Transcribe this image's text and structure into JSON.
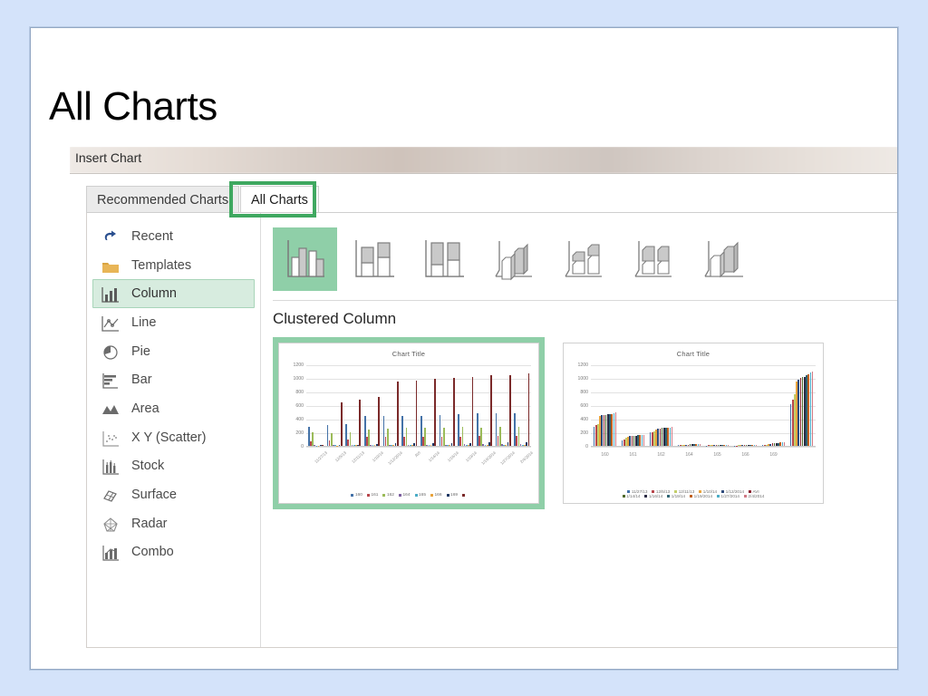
{
  "slide": {
    "title": "All Charts"
  },
  "dialog": {
    "title": "Insert Chart",
    "tabs": [
      {
        "label": "Recommended Charts",
        "selected": false
      },
      {
        "label": "All Charts",
        "selected": true
      }
    ],
    "sidebar": [
      {
        "label": "Recent",
        "icon": "undo-arrow-icon",
        "selected": false
      },
      {
        "label": "Templates",
        "icon": "folder-icon",
        "selected": false
      },
      {
        "label": "Column",
        "icon": "column-chart-icon",
        "selected": true
      },
      {
        "label": "Line",
        "icon": "line-chart-icon",
        "selected": false
      },
      {
        "label": "Pie",
        "icon": "pie-chart-icon",
        "selected": false
      },
      {
        "label": "Bar",
        "icon": "bar-chart-icon",
        "selected": false
      },
      {
        "label": "Area",
        "icon": "area-chart-icon",
        "selected": false
      },
      {
        "label": "X Y (Scatter)",
        "icon": "scatter-chart-icon",
        "selected": false
      },
      {
        "label": "Stock",
        "icon": "stock-chart-icon",
        "selected": false
      },
      {
        "label": "Surface",
        "icon": "surface-chart-icon",
        "selected": false
      },
      {
        "label": "Radar",
        "icon": "radar-chart-icon",
        "selected": false
      },
      {
        "label": "Combo",
        "icon": "combo-chart-icon",
        "selected": false
      }
    ],
    "subtypes": [
      {
        "name": "clustered-column-icon",
        "selected": true
      },
      {
        "name": "stacked-column-icon",
        "selected": false
      },
      {
        "name": "100-stacked-column-icon",
        "selected": false
      },
      {
        "name": "3d-clustered-column-icon",
        "selected": false
      },
      {
        "name": "3d-stacked-column-icon",
        "selected": false
      },
      {
        "name": "3d-100-stacked-column-icon",
        "selected": false
      },
      {
        "name": "3d-column-icon",
        "selected": false
      }
    ],
    "subtype_name": "Clustered Column",
    "colors": {
      "accent_green": "#3fa860",
      "selection_green": "#8fcfa8",
      "selection_fill": "#d7ecdf"
    }
  },
  "chart_data": [
    {
      "type": "bar",
      "title": "Chart Title",
      "xlabel": "",
      "ylabel": "",
      "ylim": [
        0,
        1200
      ],
      "yticks": [
        0,
        200,
        400,
        600,
        800,
        1000,
        1200
      ],
      "grid": true,
      "legend_position": "bottom",
      "categories": [
        "11/27/13",
        "12/5/13",
        "12/11/13",
        "1/10/14",
        "1/12/2014",
        "AVI",
        "1/14/14",
        "1/16/14",
        "1/19/14",
        "1/19/2014",
        "1/27/2014",
        "2/4/2014"
      ],
      "series": [
        {
          "name": "160",
          "color": "#4472a8",
          "values": [
            285,
            305,
            320,
            445,
            440,
            440,
            445,
            460,
            465,
            475,
            480,
            480
          ]
        },
        {
          "name": "161",
          "color": "#b8474c",
          "values": [
            65,
            80,
            90,
            130,
            130,
            135,
            130,
            130,
            140,
            145,
            150,
            150
          ]
        },
        {
          "name": "162",
          "color": "#9bbb59",
          "values": [
            195,
            190,
            200,
            245,
            260,
            265,
            265,
            265,
            275,
            270,
            280,
            280
          ]
        },
        {
          "name": "164",
          "color": "#7d60a0",
          "values": [
            8,
            10,
            12,
            20,
            18,
            20,
            18,
            20,
            22,
            22,
            24,
            24
          ]
        },
        {
          "name": "165",
          "color": "#4bacc6",
          "values": [
            6,
            8,
            9,
            14,
            14,
            15,
            15,
            16,
            16,
            17,
            18,
            18
          ]
        },
        {
          "name": "166",
          "color": "#e8a33d",
          "values": [
            5,
            6,
            7,
            10,
            10,
            11,
            11,
            12,
            12,
            13,
            13,
            14
          ]
        },
        {
          "name": "169",
          "color": "#1f3864",
          "values": [
            10,
            14,
            18,
            28,
            34,
            40,
            42,
            44,
            46,
            50,
            52,
            55
          ]
        },
        {
          "name": "",
          "color": "#7b2a2a",
          "values": [
            20,
            635,
            680,
            725,
            945,
            960,
            985,
            1005,
            1020,
            1035,
            1035,
            1070
          ]
        }
      ]
    },
    {
      "type": "bar",
      "title": "Chart Title",
      "xlabel": "",
      "ylabel": "",
      "ylim": [
        0,
        1200
      ],
      "yticks": [
        0,
        200,
        400,
        600,
        800,
        1000,
        1200
      ],
      "grid": true,
      "legend_position": "bottom",
      "categories": [
        "160",
        "161",
        "162",
        "164",
        "165",
        "166",
        "169",
        ""
      ],
      "series": [
        {
          "name": "11/27/13",
          "color": "#4472a8",
          "values": [
            285,
            85,
            195,
            8,
            6,
            5,
            10,
            615
          ]
        },
        {
          "name": "12/5/13",
          "color": "#b8474c",
          "values": [
            305,
            95,
            200,
            10,
            8,
            6,
            14,
            680
          ]
        },
        {
          "name": "12/11/13",
          "color": "#c3cf6a",
          "values": [
            320,
            120,
            215,
            12,
            9,
            7,
            18,
            760
          ]
        },
        {
          "name": "1/10/14",
          "color": "#e8a33d",
          "values": [
            440,
            140,
            245,
            18,
            12,
            9,
            26,
            950
          ]
        },
        {
          "name": "1/12/2014",
          "color": "#2f4b7c",
          "values": [
            450,
            148,
            255,
            20,
            13,
            10,
            30,
            975
          ]
        },
        {
          "name": "AVI",
          "color": "#8b2430",
          "values": [
            455,
            150,
            258,
            20,
            14,
            10,
            34,
            995
          ]
        },
        {
          "name": "1/14/14",
          "color": "#4f6a2a",
          "values": [
            458,
            150,
            262,
            21,
            14,
            11,
            38,
            1010
          ]
        },
        {
          "name": "1/16/14",
          "color": "#2b2b44",
          "values": [
            462,
            152,
            265,
            22,
            15,
            11,
            42,
            1020
          ]
        },
        {
          "name": "1/19/14",
          "color": "#2d6372",
          "values": [
            465,
            155,
            268,
            22,
            15,
            12,
            46,
            1040
          ]
        },
        {
          "name": "1/19/2014",
          "color": "#c0601f",
          "values": [
            470,
            158,
            270,
            23,
            16,
            12,
            50,
            1060
          ]
        },
        {
          "name": "1/27/2014",
          "color": "#4bacc6",
          "values": [
            478,
            160,
            272,
            24,
            17,
            13,
            52,
            1075
          ]
        },
        {
          "name": "2/4/2014",
          "color": "#d07a86",
          "values": [
            488,
            162,
            282,
            25,
            18,
            14,
            56,
            1100
          ]
        }
      ]
    }
  ]
}
